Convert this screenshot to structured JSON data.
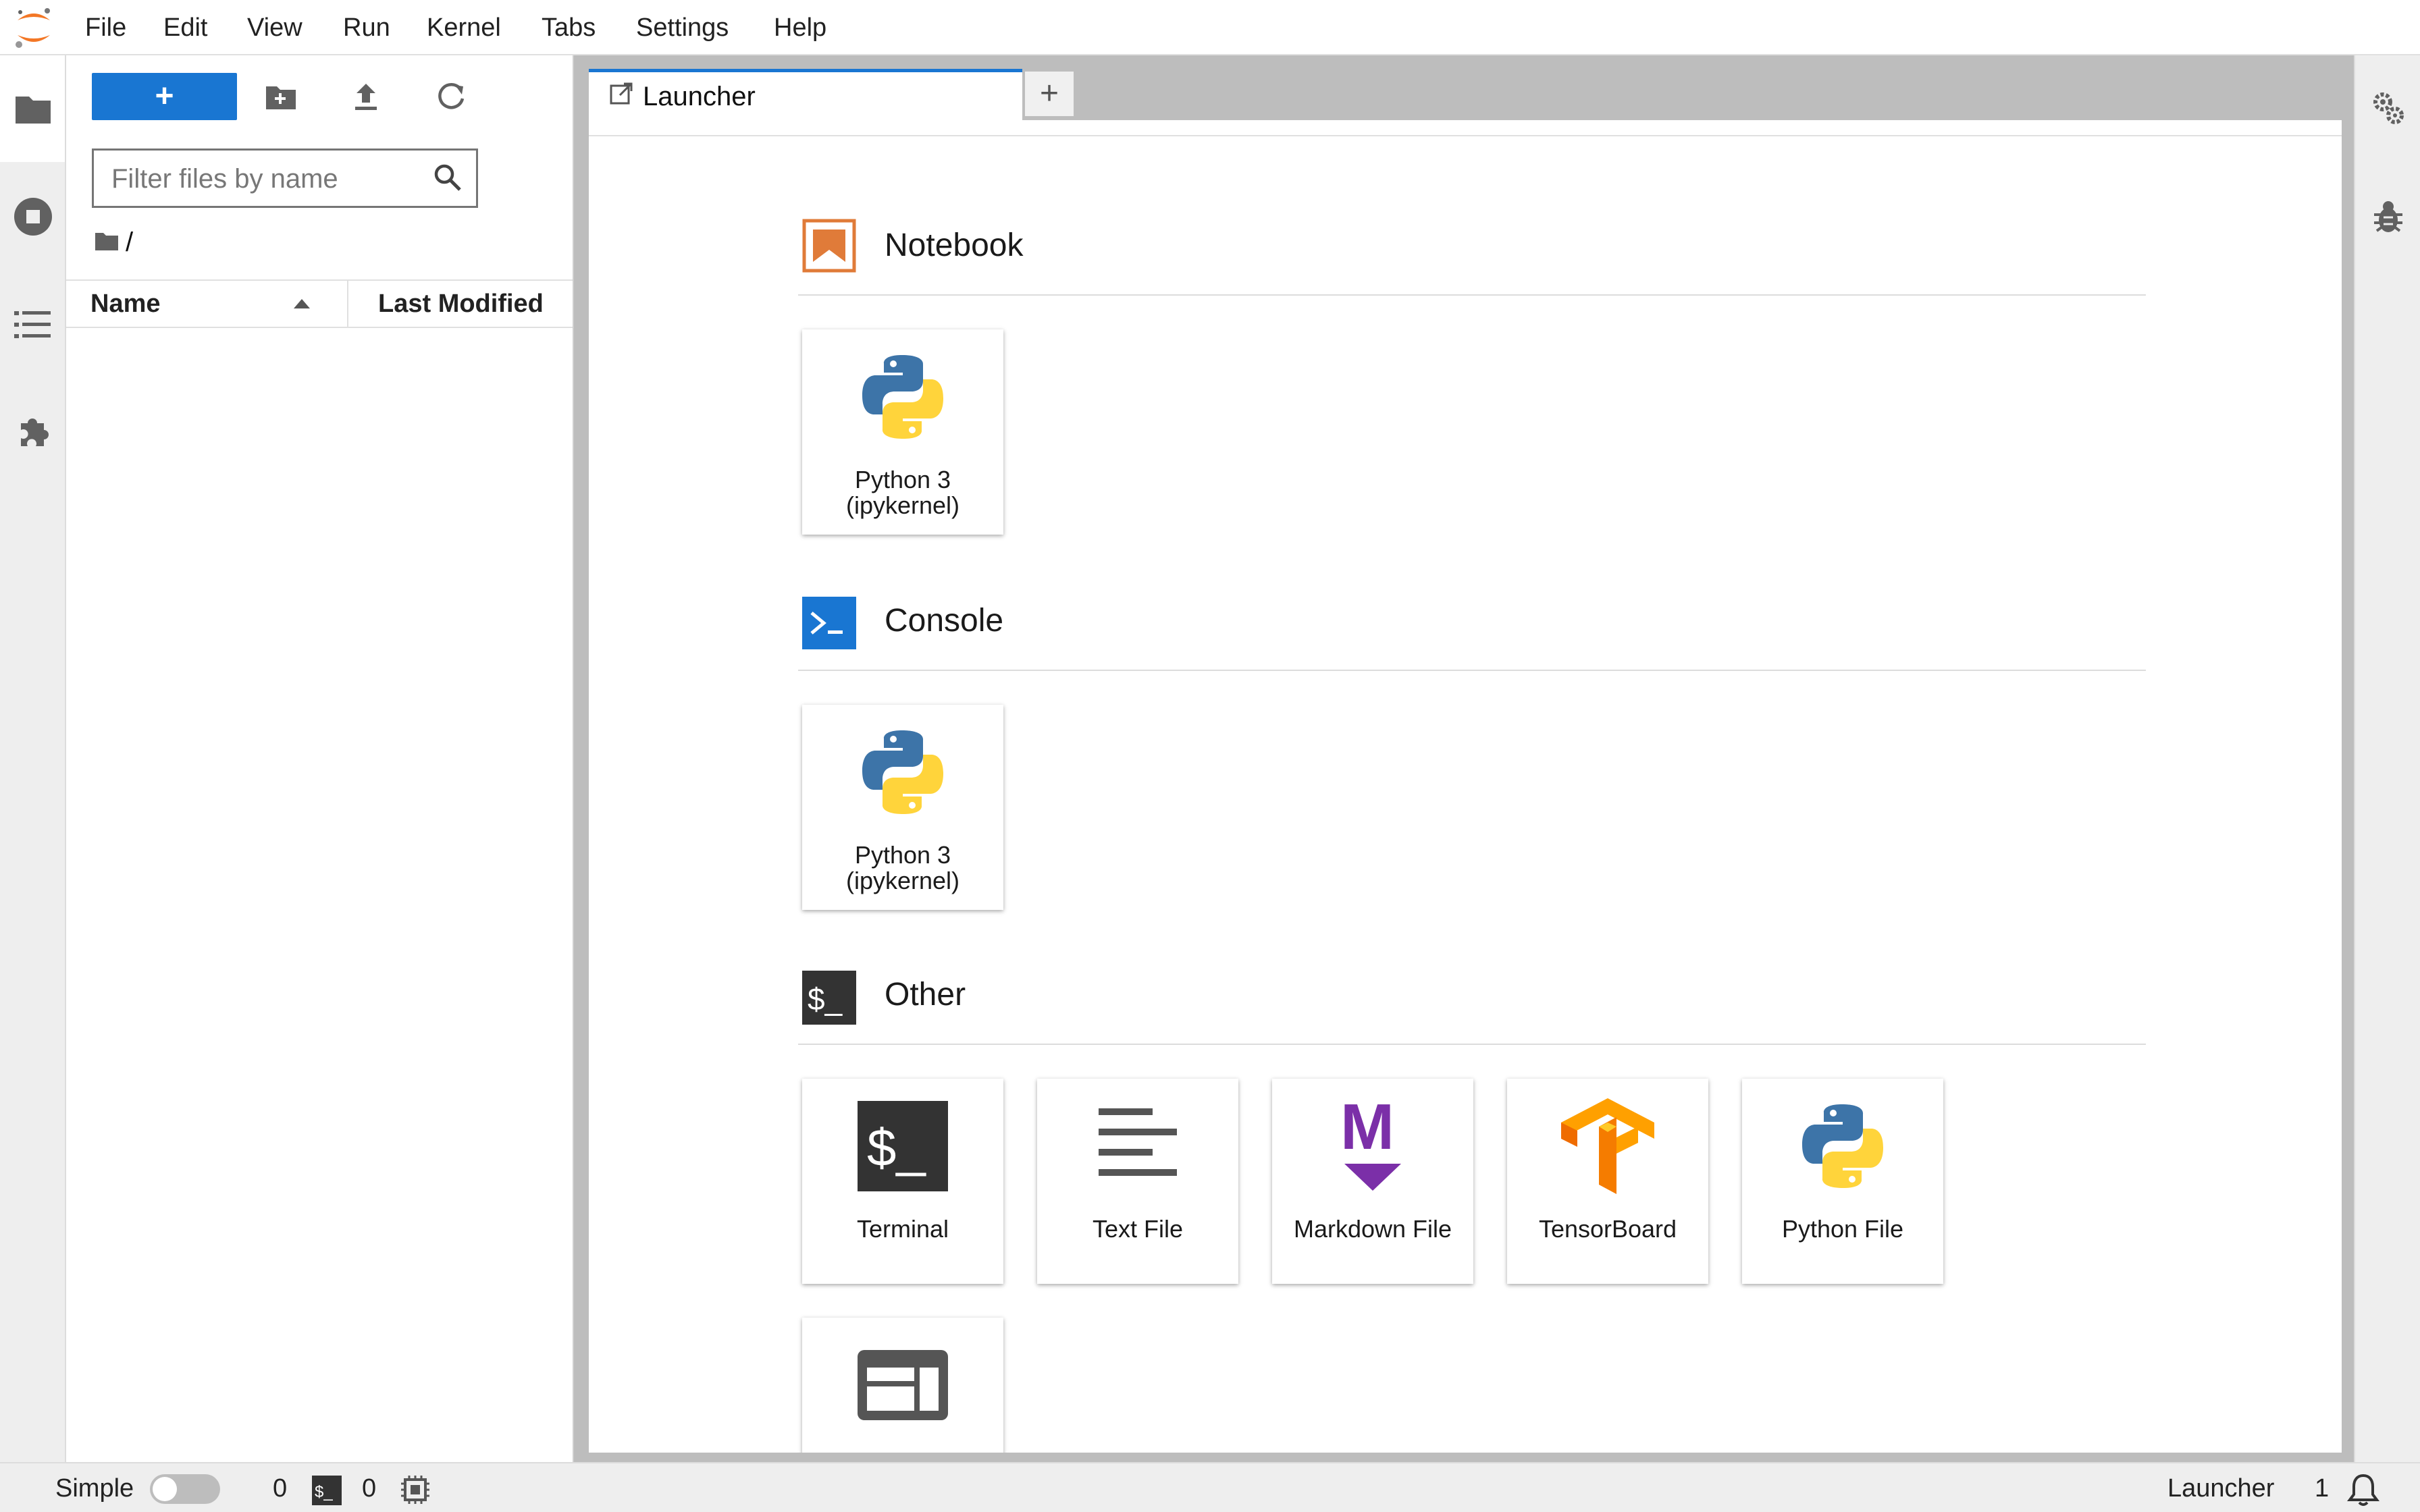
{
  "menubar": {
    "items": [
      "File",
      "Edit",
      "View",
      "Run",
      "Kernel",
      "Tabs",
      "Settings",
      "Help"
    ]
  },
  "file_browser": {
    "new_button_label": "+",
    "filter_placeholder": "Filter files by name",
    "breadcrumb": "/",
    "columns": {
      "name": "Name",
      "modified": "Last Modified"
    },
    "files": []
  },
  "tabs": [
    {
      "label": "Launcher",
      "active": true
    }
  ],
  "tab_add_label": "+",
  "launcher": {
    "sections": [
      {
        "title": "Notebook",
        "icon": "notebook-icon",
        "cards": [
          {
            "label": "Python 3\n(ipykernel)",
            "icon": "python-logo-icon"
          }
        ]
      },
      {
        "title": "Console",
        "icon": "console-icon",
        "cards": [
          {
            "label": "Python 3\n(ipykernel)",
            "icon": "python-logo-icon"
          }
        ]
      },
      {
        "title": "Other",
        "icon": "terminal-icon",
        "cards": [
          {
            "label": "Terminal",
            "icon": "terminal-icon"
          },
          {
            "label": "Text File",
            "icon": "text-file-icon"
          },
          {
            "label": "Markdown File",
            "icon": "markdown-icon"
          },
          {
            "label": "TensorBoard",
            "icon": "tensorboard-icon"
          },
          {
            "label": "Python File",
            "icon": "python-logo-icon"
          },
          {
            "label": "",
            "icon": "contextual-help-icon"
          }
        ]
      }
    ]
  },
  "statusbar": {
    "mode_label": "Simple",
    "simple_mode_on": false,
    "terminals_count": "0",
    "kernels_count": "0",
    "active_doc": "Launcher",
    "notifications_count": "1"
  },
  "colors": {
    "accent": "#1976d2",
    "notebook_orange": "#e07b39",
    "console_blue": "#1976d2",
    "markdown_purple": "#7b2fa8",
    "tensorboard_orange": "#f57c00",
    "python_blue": "#3d74a8",
    "python_yellow": "#ffd43b"
  }
}
